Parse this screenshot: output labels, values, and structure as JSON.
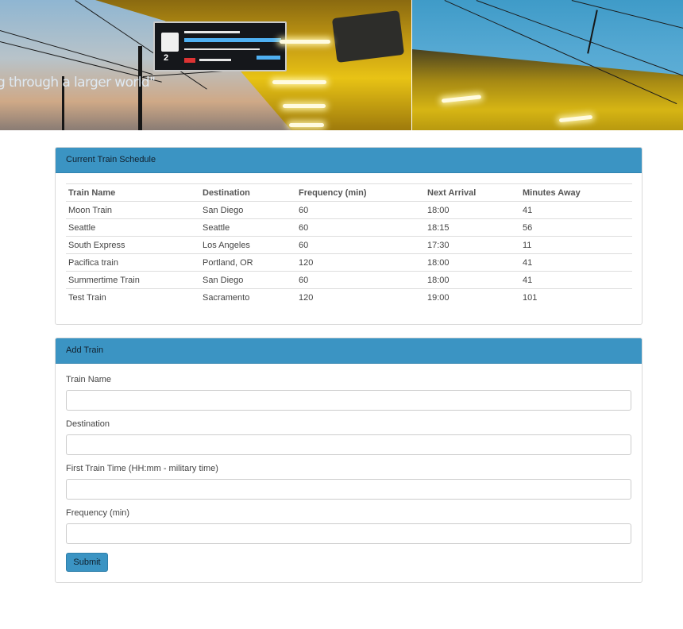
{
  "hero": {
    "caption": "g through a larger world\""
  },
  "schedule": {
    "title": "Current Train Schedule",
    "columns": [
      "Train Name",
      "Destination",
      "Frequency (min)",
      "Next Arrival",
      "Minutes Away"
    ],
    "rows": [
      [
        "Moon Train",
        "San Diego",
        "60",
        "18:00",
        "41"
      ],
      [
        "Seattle",
        "Seattle",
        "60",
        "18:15",
        "56"
      ],
      [
        "South Express",
        "Los Angeles",
        "60",
        "17:30",
        "11"
      ],
      [
        "Pacifica train",
        "Portland, OR",
        "120",
        "18:00",
        "41"
      ],
      [
        "Summertime Train",
        "San Diego",
        "60",
        "18:00",
        "41"
      ],
      [
        "Test Train",
        "Sacramento",
        "120",
        "19:00",
        "101"
      ]
    ]
  },
  "add_train": {
    "title": "Add Train",
    "fields": [
      {
        "name": "train-name-input",
        "label": "Train Name",
        "value": ""
      },
      {
        "name": "destination-input",
        "label": "Destination",
        "value": ""
      },
      {
        "name": "first-train-time-input",
        "label": "First Train Time (HH:mm - military time)",
        "value": ""
      },
      {
        "name": "frequency-input",
        "label": "Frequency (min)",
        "value": ""
      }
    ],
    "submit_label": "Submit"
  },
  "colors": {
    "panel_heading": "#3b94c3",
    "border": "#d9d9d9"
  }
}
